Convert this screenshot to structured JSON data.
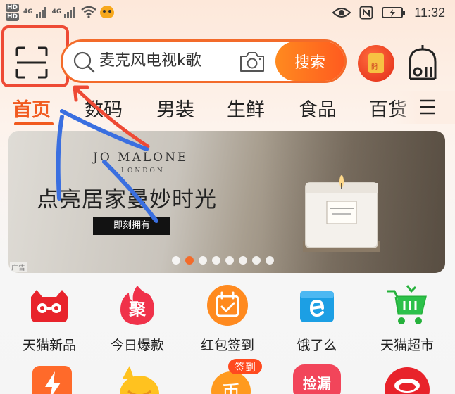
{
  "status_bar": {
    "hd1": "HD",
    "hd2": "HD",
    "net1": "4G",
    "net2": "4G",
    "time": "11:32"
  },
  "header": {
    "search_placeholder": "麦克风电视k歌",
    "search_button": "搜索"
  },
  "tabs": [
    "首页",
    "数码",
    "男装",
    "生鲜",
    "食品",
    "百货"
  ],
  "banner": {
    "brand": "JO MALONE",
    "brand_sub": "LONDON",
    "slogan": "点亮居家曼妙时光",
    "cta": "即刻拥有",
    "ad_tag": "广告",
    "carousel_total": 8,
    "carousel_active_index": 1
  },
  "quick_entries": [
    {
      "label": "天猫新品",
      "icon": "tmall-new-icon"
    },
    {
      "label": "今日爆款",
      "icon": "juhuasuan-icon",
      "icon_text": "聚"
    },
    {
      "label": "红包签到",
      "icon": "checkin-calendar-icon"
    },
    {
      "label": "饿了么",
      "icon": "eleme-icon"
    },
    {
      "label": "天猫超市",
      "icon": "tmall-supermarket-icon"
    }
  ],
  "quick_entries_row2": [
    {
      "icon": "flash-charge-icon"
    },
    {
      "icon": "duck-mascot-icon"
    },
    {
      "icon": "coin-checkin-icon",
      "badge": "签到"
    },
    {
      "icon": "bargain-icon",
      "text": "捡漏"
    },
    {
      "icon": "red-circle-icon"
    }
  ],
  "colors": {
    "accent": "#f36b2a",
    "annotation_red": "#ee4a35",
    "annotation_blue": "#3a6fe0"
  }
}
